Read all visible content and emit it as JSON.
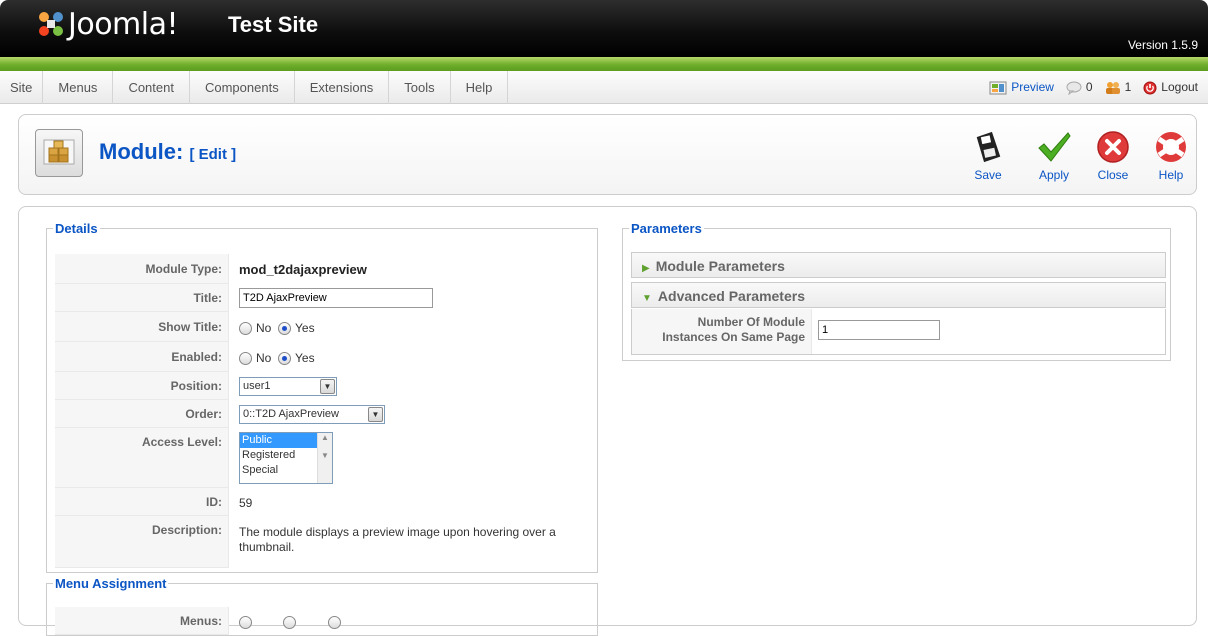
{
  "header": {
    "brand": "Joomla!",
    "site_name": "Test Site",
    "version": "Version 1.5.9"
  },
  "menu": {
    "items": [
      "Site",
      "Menus",
      "Content",
      "Components",
      "Extensions",
      "Tools",
      "Help"
    ]
  },
  "status": {
    "preview": "Preview",
    "messages_count": "0",
    "users_count": "1",
    "logout": "Logout"
  },
  "toolbar": {
    "title": "Module:",
    "subtitle": "[ Edit ]",
    "save": "Save",
    "apply": "Apply",
    "close": "Close",
    "help": "Help"
  },
  "details": {
    "legend": "Details",
    "module_type_label": "Module Type:",
    "module_type_value": "mod_t2dajaxpreview",
    "title_label": "Title:",
    "title_value": "T2D AjaxPreview",
    "show_title_label": "Show Title:",
    "enabled_label": "Enabled:",
    "no_label": "No",
    "yes_label": "Yes",
    "position_label": "Position:",
    "position_value": "user1",
    "order_label": "Order:",
    "order_value": "0::T2D AjaxPreview",
    "access_label": "Access Level:",
    "access_options": [
      "Public",
      "Registered",
      "Special"
    ],
    "id_label": "ID:",
    "id_value": "59",
    "description_label": "Description:",
    "description_value": "The module displays a preview image upon hovering over a thumbnail."
  },
  "menu_assignment": {
    "legend": "Menu Assignment",
    "menus_label": "Menus:"
  },
  "parameters": {
    "legend": "Parameters",
    "module_params": "Module Parameters",
    "advanced_params": "Advanced Parameters",
    "instances_label_line1": "Number Of Module",
    "instances_label_line2": "Instances On Same Page",
    "instances_value": "1"
  },
  "colors": {
    "link_blue": "#0b55c4",
    "header_green": "#6fae2a"
  }
}
